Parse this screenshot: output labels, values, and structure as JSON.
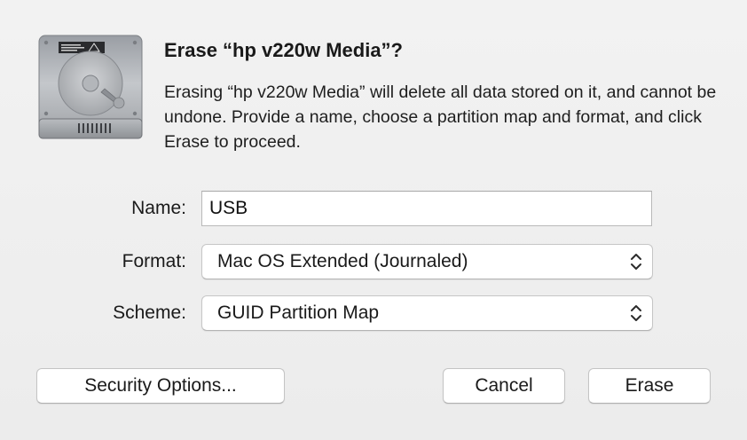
{
  "dialog": {
    "title": "Erase “hp v220w Media”?",
    "message": "Erasing “hp v220w Media” will delete all data stored on it, and cannot be undone. Provide a name, choose a partition map and format, and click Erase to proceed.",
    "icon": "hard-disk-icon"
  },
  "form": {
    "name_label": "Name:",
    "name_value": "USB",
    "format_label": "Format:",
    "format_value": "Mac OS Extended (Journaled)",
    "scheme_label": "Scheme:",
    "scheme_value": "GUID Partition Map",
    "popup_icon": "up-down-chevron-icon"
  },
  "buttons": {
    "security_options": "Security Options...",
    "cancel": "Cancel",
    "erase": "Erase"
  }
}
